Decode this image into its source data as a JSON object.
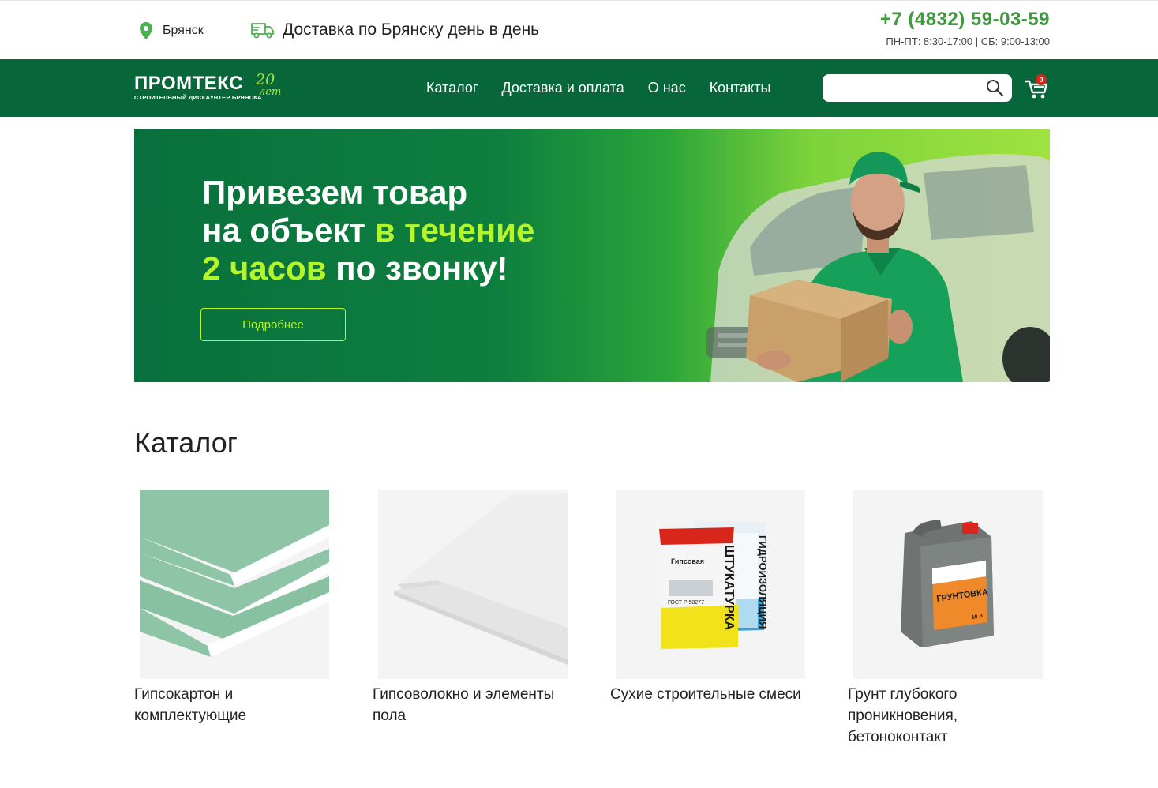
{
  "topbar": {
    "city": "Брянск",
    "delivery": "Доставка по Брянску день в день",
    "phone": "+7 (4832) 59-03-59",
    "hours": "ПН-ПТ: 8:30-17:00 | СБ: 9:00-13:00"
  },
  "header": {
    "logo_main": "ПРОМТЕКС",
    "logo_sub": "СТРОИТЕЛЬНЫЙ ДИСКАУНТЕР БРЯНСКА",
    "logo_years_num": "20",
    "logo_years_word": "лет",
    "nav": [
      "Каталог",
      "Доставка и оплата",
      "О нас",
      "Контакты"
    ],
    "search_placeholder": "",
    "cart_count": "0"
  },
  "banner": {
    "line1": "Привезем товар",
    "line2_start": "на объект ",
    "line2_highlight": "в течение",
    "line3_highlight": "2 часов",
    "line3_end": " по звонку!",
    "button": "Подробнее"
  },
  "catalog": {
    "title": "Каталог",
    "items": [
      {
        "label": "Гипсокартон и комплектующие"
      },
      {
        "label": "Гипсоволокно и элементы пола"
      },
      {
        "label": "Сухие строительные смеси"
      },
      {
        "label": "Грунт глубокого проникновения, бетоноконтакт"
      }
    ],
    "product_texts": {
      "bag1_brand": "Гипсовая",
      "bag1_name": "ШТУКАТУРКА",
      "bag1_std": "ГОСТ Р 58277",
      "bag2_name": "ГИДРОИЗОЛЯЦИЯ",
      "can_name": "ГРУНТОВКА",
      "can_vol": "10 л"
    }
  },
  "colors": {
    "brand_green": "#07673a",
    "accent_lime": "#b6f528",
    "phone_green": "#3e9a3c",
    "badge_red": "#d9261c"
  }
}
